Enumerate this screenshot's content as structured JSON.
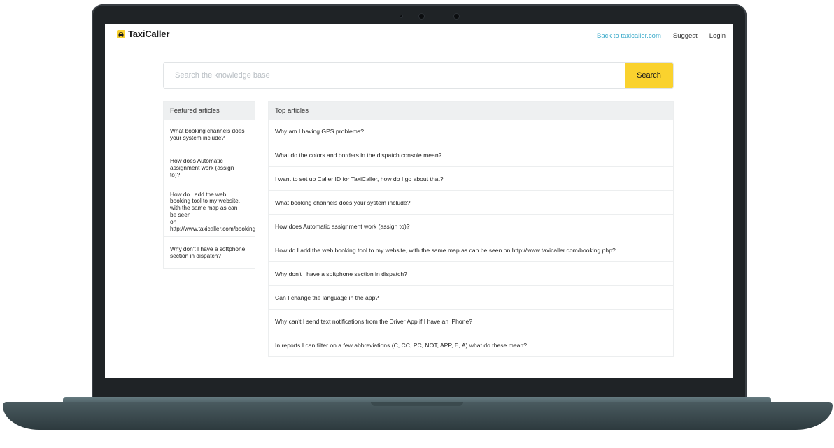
{
  "brand": {
    "name": "TaxiCaller",
    "accent": "#38a9c9",
    "button_color": "#fad22e"
  },
  "nav": {
    "back_link": "Back to taxicaller.com",
    "suggest": "Suggest",
    "login": "Login"
  },
  "search": {
    "placeholder": "Search the knowledge base",
    "button_label": "Search"
  },
  "featured": {
    "title": "Featured articles",
    "items": [
      "What booking channels does\nyour system include?",
      "How does Automatic\nassignment work (assign\nto)?",
      "How do I add the web\nbooking tool to my website,\nwith the same map as can\nbe seen\non http://www.taxicaller.com/booking.php?",
      "Why don't I have a softphone\nsection in dispatch?"
    ]
  },
  "top": {
    "title": "Top articles",
    "items": [
      "Why am I having GPS problems?",
      "What do the colors and borders in the dispatch console mean?",
      "I want to set up Caller ID for TaxiCaller, how do I go about that?",
      "What booking channels does your system include?",
      "How does Automatic assignment work (assign to)?",
      "How do I add the web booking tool to my website, with the same map as can be seen on http://www.taxicaller.com/booking.php?",
      "Why don't I have a softphone section in dispatch?",
      "Can I change the language in the app?",
      "Why can't I send text notifications from the Driver App if I have an iPhone?",
      "In reports I can filter on a few abbreviations (C, CC, PC, NOT, APP, E, A) what do these mean?"
    ]
  }
}
